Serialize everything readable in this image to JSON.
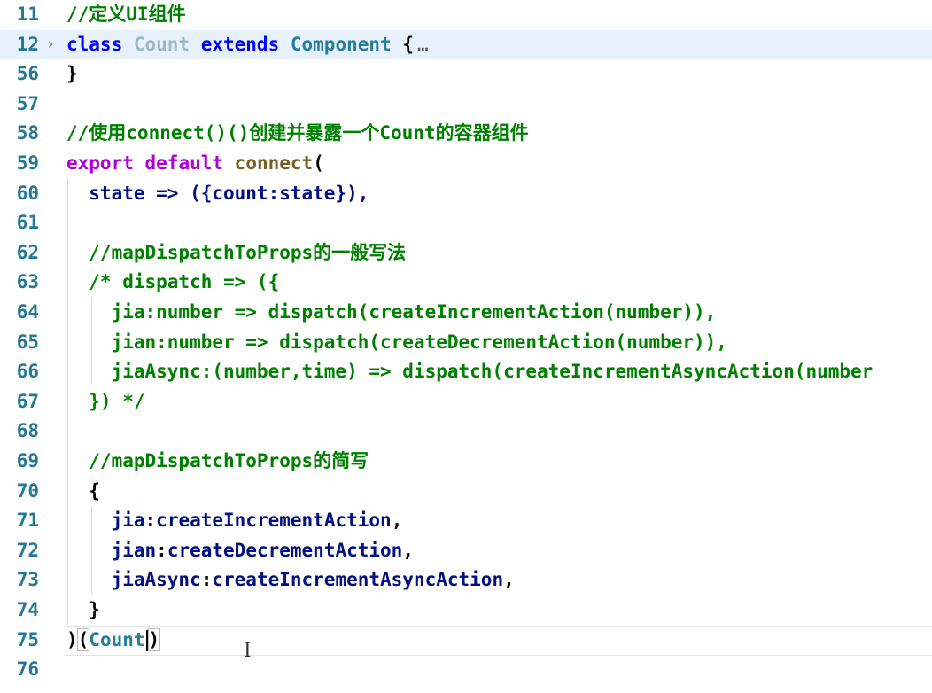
{
  "editor": {
    "lines": [
      {
        "num": "11",
        "tokens": [
          {
            "t": "//定义UI组件",
            "c": "#008000"
          }
        ]
      },
      {
        "num": "12",
        "fold": "›",
        "highlighted": true,
        "tokens": [
          {
            "t": "class ",
            "c": "#0000ff"
          },
          {
            "t": "Count ",
            "c": "#9cb7c6"
          },
          {
            "t": "extends ",
            "c": "#0000ff"
          },
          {
            "t": "Component ",
            "c": "#267f99"
          },
          {
            "t": "{",
            "c": "#000000"
          },
          {
            "t": "…",
            "c": "#555555",
            "cls": "ellipsis"
          }
        ]
      },
      {
        "num": "56",
        "tokens": [
          {
            "t": "}",
            "c": "#000000"
          }
        ]
      },
      {
        "num": "57",
        "tokens": []
      },
      {
        "num": "58",
        "tokens": [
          {
            "t": "//使用connect()()创建并暴露一个Count的容器组件",
            "c": "#008000"
          }
        ]
      },
      {
        "num": "59",
        "tokens": [
          {
            "t": "export ",
            "c": "#af00db"
          },
          {
            "t": "default ",
            "c": "#af00db"
          },
          {
            "t": "connect",
            "c": "#795e26"
          },
          {
            "t": "(",
            "c": "#000000"
          }
        ]
      },
      {
        "num": "60",
        "tokens": [
          {
            "t": "  state => ({count:state}),",
            "c": "#001080"
          }
        ]
      },
      {
        "num": "61",
        "tokens": []
      },
      {
        "num": "62",
        "tokens": [
          {
            "t": "  //mapDispatchToProps的一般写法",
            "c": "#008000"
          }
        ]
      },
      {
        "num": "63",
        "tokens": [
          {
            "t": "  /* dispatch => ({",
            "c": "#008000"
          }
        ]
      },
      {
        "num": "64",
        "tokens": [
          {
            "t": "    jia:number => dispatch(createIncrementAction(number)),",
            "c": "#008000"
          }
        ]
      },
      {
        "num": "65",
        "tokens": [
          {
            "t": "    jian:number => dispatch(createDecrementAction(number)),",
            "c": "#008000"
          }
        ]
      },
      {
        "num": "66",
        "tokens": [
          {
            "t": "    jiaAsync:(number,time) => dispatch(createIncrementAsyncAction(number",
            "c": "#008000"
          }
        ]
      },
      {
        "num": "67",
        "tokens": [
          {
            "t": "  }) */",
            "c": "#008000"
          }
        ]
      },
      {
        "num": "68",
        "tokens": []
      },
      {
        "num": "69",
        "tokens": [
          {
            "t": "  //mapDispatchToProps的简写",
            "c": "#008000"
          }
        ]
      },
      {
        "num": "70",
        "tokens": [
          {
            "t": "  {",
            "c": "#000000"
          }
        ]
      },
      {
        "num": "71",
        "tokens": [
          {
            "t": "    jia",
            "c": "#001080"
          },
          {
            "t": ":",
            "c": "#000000"
          },
          {
            "t": "createIncrementAction",
            "c": "#001080"
          },
          {
            "t": ",",
            "c": "#000000"
          }
        ]
      },
      {
        "num": "72",
        "tokens": [
          {
            "t": "    jian",
            "c": "#001080"
          },
          {
            "t": ":",
            "c": "#000000"
          },
          {
            "t": "createDecrementAction",
            "c": "#001080"
          },
          {
            "t": ",",
            "c": "#000000"
          }
        ]
      },
      {
        "num": "73",
        "tokens": [
          {
            "t": "    jiaAsync",
            "c": "#001080"
          },
          {
            "t": ":",
            "c": "#000000"
          },
          {
            "t": "createIncrementAsyncAction",
            "c": "#001080"
          },
          {
            "t": ",",
            "c": "#000000"
          }
        ]
      },
      {
        "num": "74",
        "tokens": [
          {
            "t": "  }",
            "c": "#000000"
          }
        ]
      },
      {
        "num": "75",
        "cursorLine": true,
        "tokens": [
          {
            "t": ")",
            "c": "#000000"
          },
          {
            "t": "(",
            "c": "#000000",
            "cls": "bracket-box"
          },
          {
            "t": "Count",
            "c": "#267f99"
          },
          {
            "caret": true
          },
          {
            "t": ")",
            "c": "#000000",
            "cls": "bracket-box"
          }
        ]
      },
      {
        "num": "76",
        "tokens": []
      }
    ]
  }
}
